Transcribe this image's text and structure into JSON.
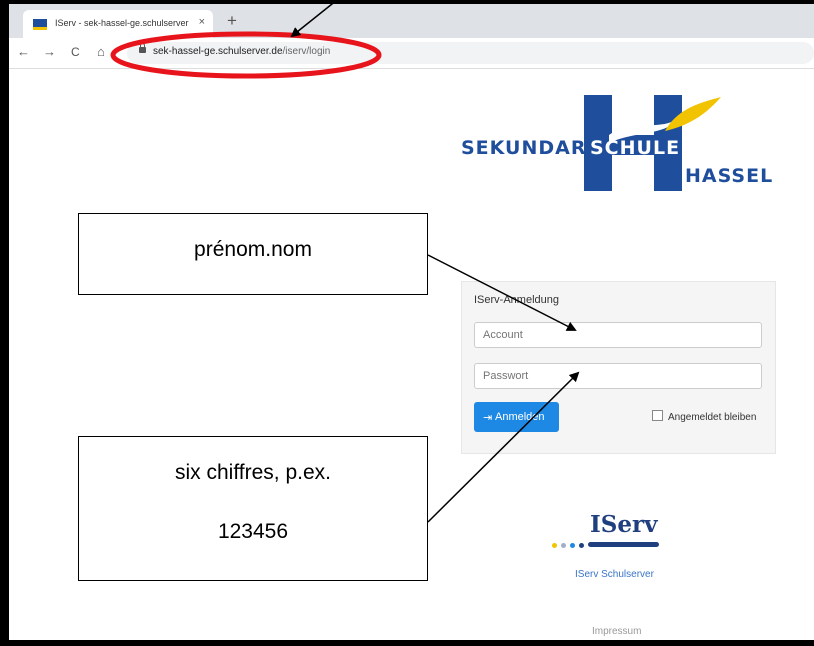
{
  "browser": {
    "tab_title": "IServ - sek-hassel-ge.schulserver",
    "tab_close": "×",
    "new_tab": "+",
    "nav_back": "←",
    "nav_forward": "→",
    "nav_reload": "C",
    "nav_home": "⌂",
    "url_host": "sek-hassel-ge.schulserver.de",
    "url_path": "/iserv/login"
  },
  "logo": {
    "line1_a": "SEKUNDAR",
    "line1_b": "SCHULE",
    "line2": "HASSEL",
    "color_blue": "#1f4e9c",
    "color_yellow": "#f2c300"
  },
  "login": {
    "title": "IServ-Anmeldung",
    "account_placeholder": "Account",
    "password_placeholder": "Passwort",
    "button_label": "Anmelden",
    "button_icon": "sign-in-icon",
    "remember_label": "Angemeldet bleiben"
  },
  "footer": {
    "iserv_wordmark": "IServ",
    "iserv_link": "IServ Schulserver",
    "impressum": "Impressum"
  },
  "annotations": {
    "box1_text": "prénom.nom",
    "box2_line1": "six chiffres, p.ex.",
    "box2_line2": "123456",
    "highlight_color": "#e8141c"
  }
}
